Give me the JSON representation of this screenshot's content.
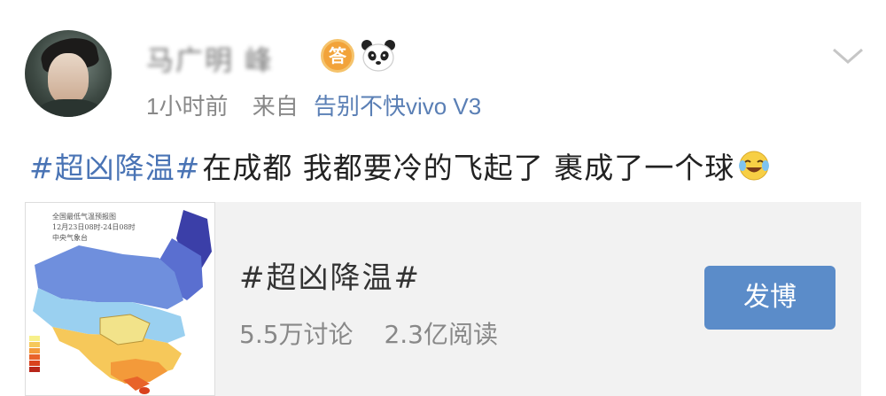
{
  "post": {
    "username": "马广明 峰",
    "badge_label": "答",
    "timestamp": "1小时前",
    "source_label": "来自",
    "device": "告别不快vivo V3",
    "hashtag": "#超凶降温#",
    "body": "在成都 我都要冷的飞起了 裹成了一个球",
    "icons": {
      "badge": "answer-badge-icon",
      "member": "panda-icon",
      "menu": "chevron-down-icon",
      "emoji": "laugh-cry-emoji-icon"
    }
  },
  "card": {
    "title": "#超凶降温#",
    "discussions": "5.5万讨论",
    "reads": "2.3亿阅读",
    "button_label": "发博",
    "map_caption_line1": "全国最低气温预报图",
    "map_caption_line2": "12月23日08时-24日08时",
    "map_caption_line3": "中央气象台"
  },
  "colors": {
    "link": "#4a74b5",
    "button": "#5b8cc9",
    "card_bg": "#f2f2f2"
  }
}
